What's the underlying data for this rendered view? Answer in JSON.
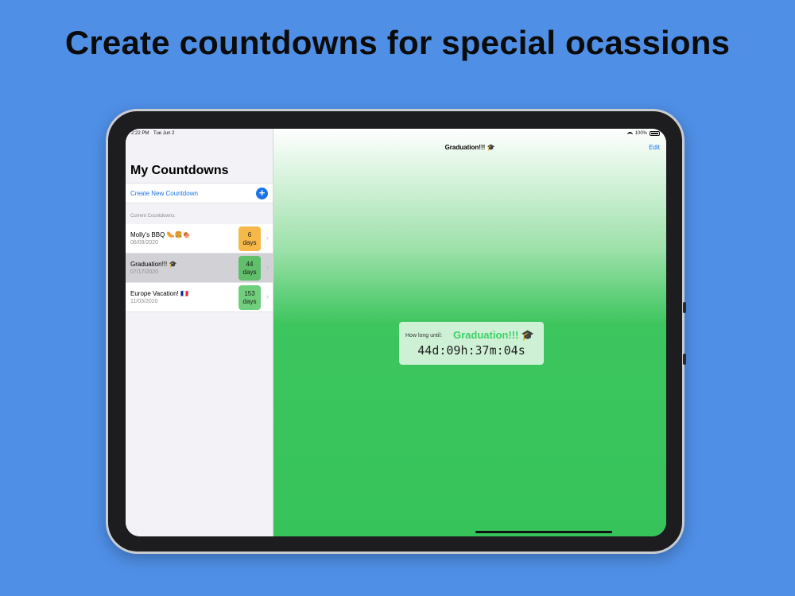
{
  "headline": "Create countdowns for special ocassions",
  "status_bar": {
    "time": "2:22 PM",
    "date": "Tue Jun 2",
    "battery": "100%"
  },
  "sidebar": {
    "title": "My Countdowns",
    "create_label": "Create New Countdown",
    "create_icon": "+",
    "section_label": "Current Countdowns:",
    "chevron": "›",
    "items": [
      {
        "name": "Molly's BBQ 🌭🍔🍖",
        "date": "06/09/2020",
        "badge_number": "6",
        "badge_unit": "days",
        "badge_color": "#f7b84a",
        "selected": false
      },
      {
        "name": "Graduation!!! 🎓",
        "date": "07/17/2020",
        "badge_number": "44",
        "badge_unit": "days",
        "badge_color": "#5fbf6a",
        "selected": true
      },
      {
        "name": "Europe Vacation! 🇫🇷",
        "date": "11/03/2020",
        "badge_number": "153",
        "badge_unit": "days",
        "badge_color": "#6fcf7c",
        "selected": false
      }
    ]
  },
  "detail": {
    "nav_title": "Graduation!!! 🎓",
    "edit_label": "Edit",
    "card_label": "How long until:",
    "card_name": "Graduation!!! 🎓",
    "timer": "44d:09h:37m:04s"
  },
  "colors": {
    "background": "#4f8fe6",
    "accent": "#1a73e8",
    "green": "#36c45a"
  }
}
